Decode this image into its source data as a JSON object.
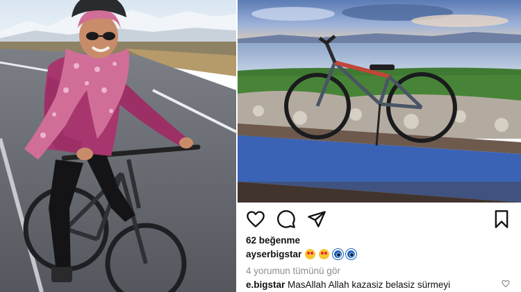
{
  "post": {
    "likes_text": "62 beğenme",
    "caption": {
      "username": "ayserbigstar",
      "emojis": [
        "heart-eyes-emoji",
        "heart-eyes-emoji",
        "nazar-emoji",
        "nazar-emoji"
      ]
    },
    "view_comments": "4 yorumun tümünü gör",
    "comment": {
      "username": "e.bigstar",
      "text": "MasAllah Allah kazasiz belasiz sürmeyi"
    }
  },
  "icons": {
    "like": "heart-icon",
    "comment": "comment-bubble-icon",
    "share": "paper-plane-icon",
    "save": "bookmark-icon",
    "comment_like": "small-heart-icon"
  },
  "colors": {
    "text": "#111111",
    "muted": "#8e8e8e",
    "jacket": "#a8366e",
    "lake": "#8fa7c9",
    "bench": "#3a62b5"
  }
}
